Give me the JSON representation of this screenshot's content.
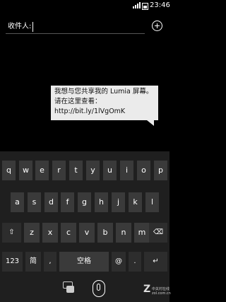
{
  "status_bar": {
    "time": "23:46"
  },
  "compose": {
    "to_label": "收件人:",
    "to_value": ""
  },
  "message": {
    "lines": [
      "我想与您共享我的 Lumia 屏幕。",
      "请在这里查看：",
      "http://bit.ly/1lVgOmK"
    ]
  },
  "keyboard": {
    "row1": [
      "q",
      "w",
      "e",
      "r",
      "t",
      "y",
      "u",
      "i",
      "o",
      "p"
    ],
    "row2": [
      "a",
      "s",
      "d",
      "f",
      "g",
      "h",
      "j",
      "k",
      "l"
    ],
    "row3": [
      "⇧",
      "z",
      "x",
      "c",
      "v",
      "b",
      "n",
      "m",
      "⌫"
    ],
    "row4": [
      "123",
      "简",
      ",",
      "空格",
      "@",
      ".",
      "↵"
    ]
  },
  "watermark": {
    "mark": "Z",
    "line1": "中关村在线",
    "line2": "zol.com.cn"
  }
}
